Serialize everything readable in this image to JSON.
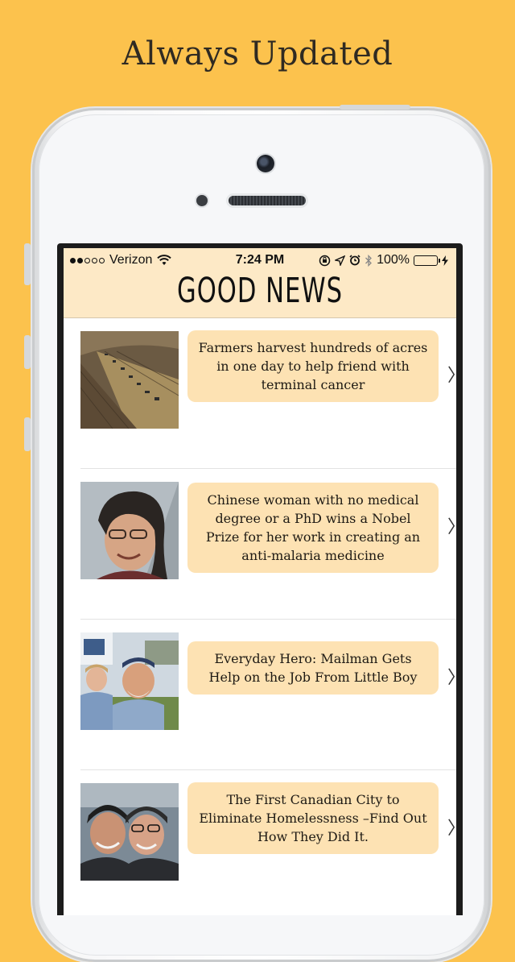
{
  "promo": {
    "title": "Always Updated"
  },
  "status_bar": {
    "carrier": "Verizon",
    "time": "7:24 PM",
    "battery": "100%",
    "signal_bars_filled": 2,
    "signal_bars_total": 5
  },
  "navbar": {
    "title": "GOOD NEWS"
  },
  "feed": {
    "items": [
      {
        "headline": "Farmers harvest hundreds of acres in one day to help friend with terminal cancer",
        "image": "harvest-field-photo"
      },
      {
        "headline": "Chinese woman with no medical degree or a PhD wins a Nobel Prize for her work in creating an anti-malaria medicine",
        "image": "woman-portrait-photo"
      },
      {
        "headline": "Everyday Hero: Mailman Gets Help on the Job From Little Boy",
        "image": "mailman-and-boy-photo"
      },
      {
        "headline": "The First Canadian City to Eliminate Homelessness –Find Out How They Did It.",
        "image": "two-people-smiling-photo"
      }
    ]
  },
  "colors": {
    "background": "#fcc24d",
    "navbar": "#fde9c6",
    "card": "#fde2b3",
    "battery_fill": "#4cd964"
  }
}
